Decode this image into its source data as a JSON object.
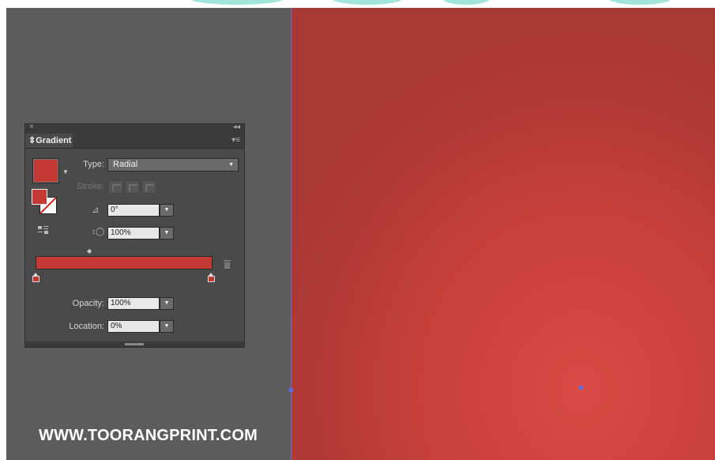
{
  "panel": {
    "title": "Gradient",
    "type_label": "Type:",
    "type_value": "Radial",
    "stroke_label": "Stroke:",
    "angle_value": "0°",
    "aspect_value": "100%",
    "opacity_label": "Opacity:",
    "opacity_value": "100%",
    "location_label": "Location:",
    "location_value": "0%",
    "close_glyph": "×",
    "collapse_glyph": "◂◂",
    "tab_prefix": "⇕",
    "menu_glyph": "▾≡",
    "dropdown_glyph": "▼",
    "gradient_color": "#c33a35"
  },
  "canvas": {
    "artboard_colors": [
      "#d84a44",
      "#a83834"
    ],
    "workspace_color": "#5c5c5c"
  },
  "watermark": "WWW.TOORANGPRINT.COM",
  "icons": [
    "close-icon",
    "collapse-icon",
    "panel-menu-icon",
    "fill-swatch",
    "fill-stroke-icon",
    "reverse-gradient-icon",
    "angle-icon",
    "aspect-ratio-icon",
    "midpoint-icon",
    "trash-icon"
  ]
}
